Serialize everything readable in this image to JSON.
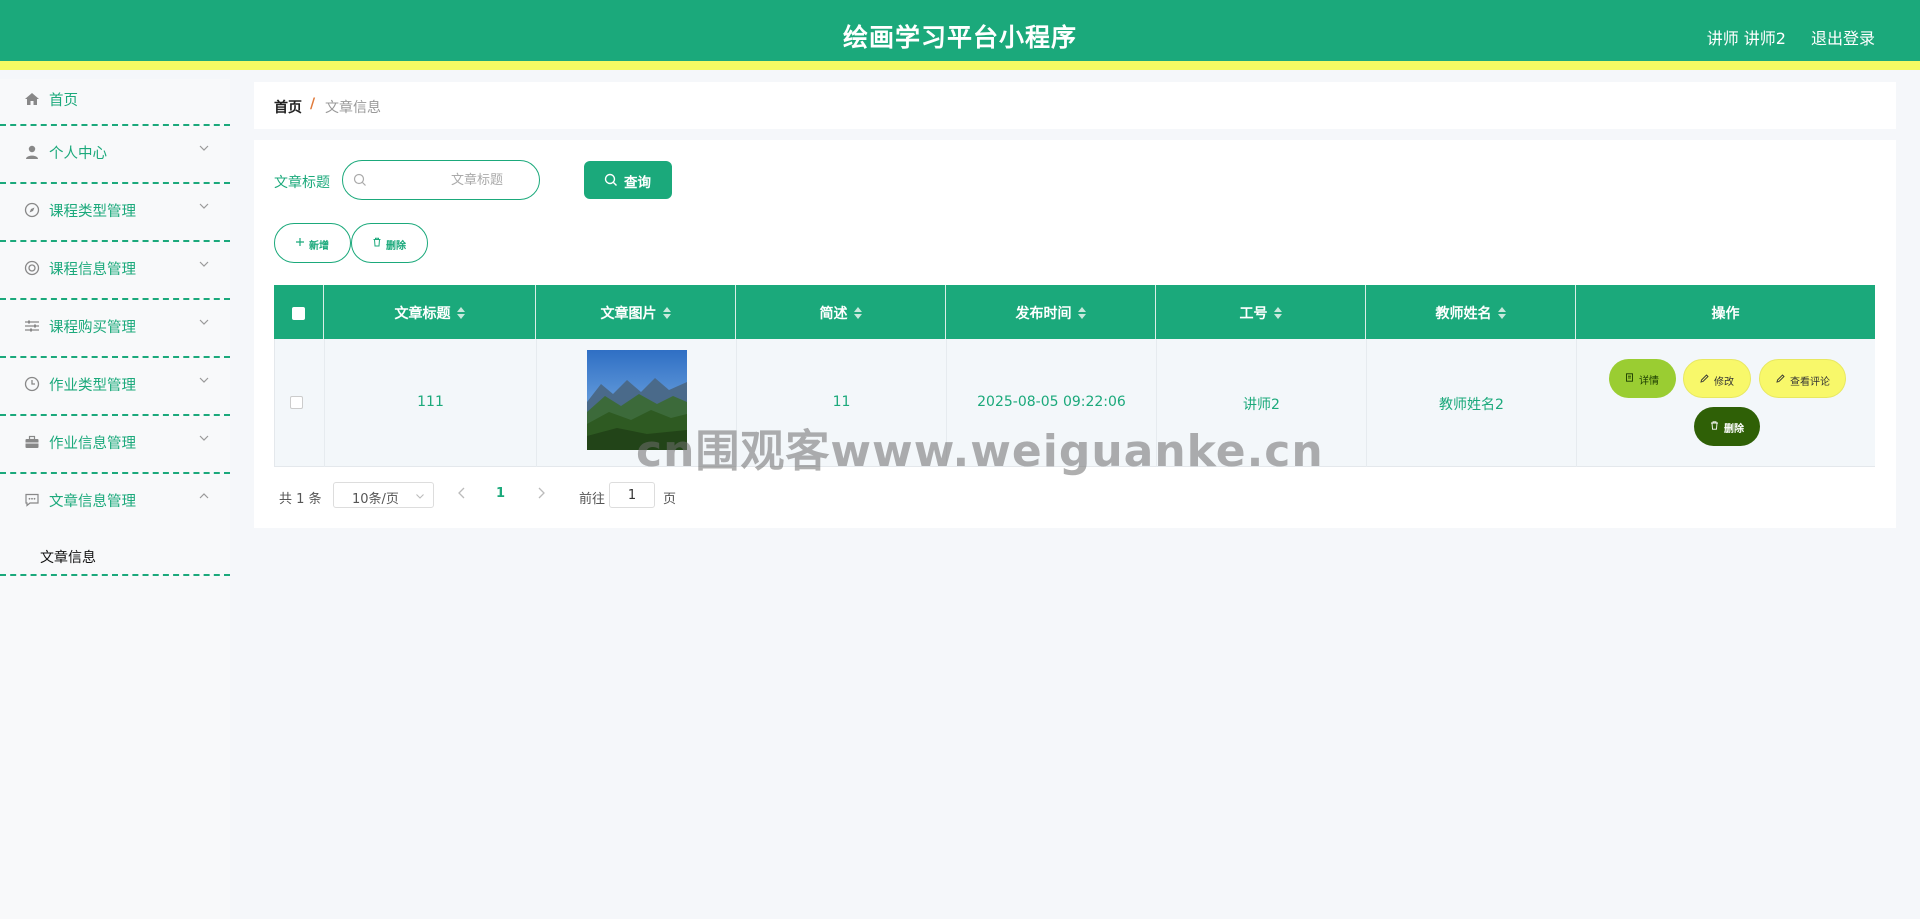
{
  "header": {
    "title": "绘画学习平台小程序",
    "user": "讲师 讲师2",
    "logout": "退出登录"
  },
  "sidebar": {
    "items": [
      {
        "label": "首页",
        "icon": "home-icon"
      },
      {
        "label": "个人中心",
        "icon": "user-icon"
      },
      {
        "label": "课程类型管理",
        "icon": "compass-icon"
      },
      {
        "label": "课程信息管理",
        "icon": "lifebuoy-icon"
      },
      {
        "label": "课程购买管理",
        "icon": "sliders-icon"
      },
      {
        "label": "作业类型管理",
        "icon": "clock-icon"
      },
      {
        "label": "作业信息管理",
        "icon": "briefcase-icon"
      },
      {
        "label": "文章信息管理",
        "icon": "chat-icon"
      }
    ],
    "sub_items": [
      {
        "label": "文章信息"
      }
    ]
  },
  "breadcrumb": {
    "home": "首页",
    "separator": "/",
    "current": "文章信息"
  },
  "search": {
    "label": "文章标题",
    "placeholder": "文章标题",
    "button": "查询"
  },
  "actions": {
    "add": "新增",
    "delete": "删除"
  },
  "table": {
    "columns": [
      "文章标题",
      "文章图片",
      "简述",
      "发布时间",
      "工号",
      "教师姓名",
      "操作"
    ],
    "rows": [
      {
        "title": "111",
        "summary": "11",
        "publish_time": "2025-08-05 09:22:06",
        "job_no": "讲师2",
        "teacher_name": "教师姓名2",
        "ops": {
          "detail": "详情",
          "edit": "修改",
          "comments": "查看评论",
          "remove": "删除"
        }
      }
    ]
  },
  "pagination": {
    "total": "共 1 条",
    "page_size": "10条/页",
    "current_page": "1",
    "goto_label": "前往",
    "goto_value": "1",
    "page_suffix": "页"
  },
  "watermark": "cn围观客www.weiguanke.cn",
  "colors": {
    "primary": "#1ba97b",
    "header_stripe": "#f4fa63",
    "detail_button": "#9acd32",
    "edit_button": "#f8f86a",
    "remove_button": "#2f6006"
  }
}
